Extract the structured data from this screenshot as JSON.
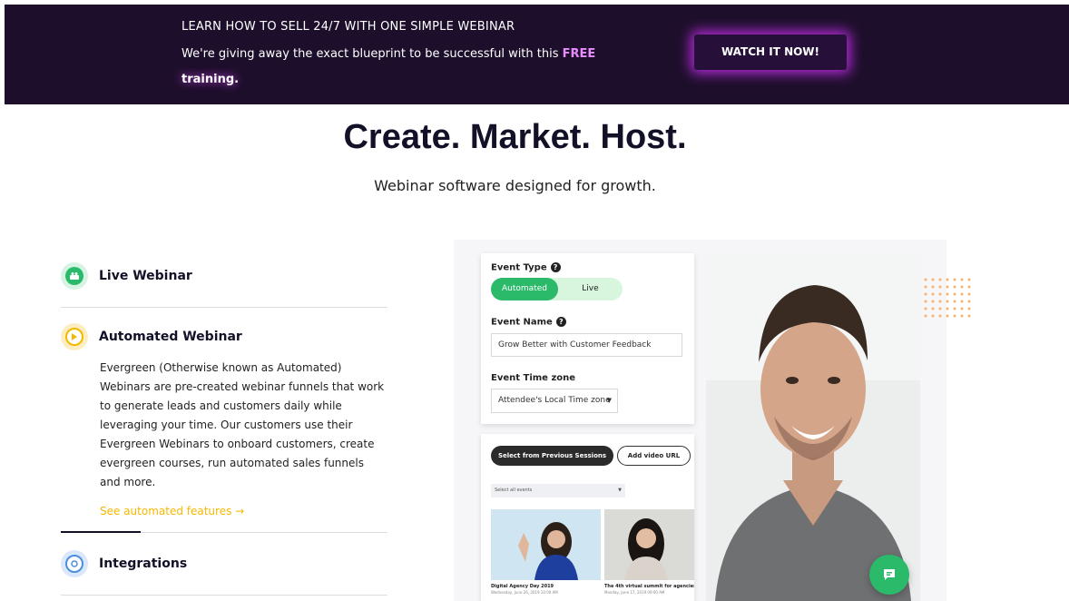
{
  "banner": {
    "title": "LEARN HOW TO SELL 24/7 WITH ONE SIMPLE WEBINAR",
    "text_prefix": "We're giving away the exact blueprint to be successful with this ",
    "text_free": "FREE",
    "text_training": "training.",
    "cta_label": "WATCH IT NOW!"
  },
  "hero": {
    "headline": "Create. Market. Host.",
    "subline": "Webinar software designed for growth."
  },
  "features": {
    "live_label": "Live Webinar",
    "automated_label": "Automated Webinar",
    "automated_desc": "Evergreen (Otherwise known as Automated) Webinars are pre-created webinar funnels that work to generate leads and customers daily while leveraging your time. Our customers use their Evergreen Webinars to onboard customers, create evergreen courses, run automated sales funnels and more.",
    "automated_link": "See automated features →",
    "integrations_label": "Integrations"
  },
  "app": {
    "event_type_label": "Event Type",
    "toggle_automated": "Automated",
    "toggle_live": "Live",
    "event_name_label": "Event Name",
    "event_name_value": "Grow Better with Customer Feedback",
    "event_tz_label": "Event Time zone",
    "event_tz_value": "Attendee's Local Time zone",
    "select_prev_label": "Select from Previous Sessions",
    "add_video_label": "Add video URL",
    "select_events_placeholder": "Select all events",
    "session1_title": "Digital Agency Day 2019",
    "session1_date": "Wednesday, June 26, 2019 10:00 AM",
    "session2_title": "The 4th virtual summit for agencies -",
    "session2_date": "Monday, June 17, 2019 09:00 AM"
  },
  "colors": {
    "banner_bg": "#1d0f2b",
    "cta_glow": "#b52bd9",
    "accent_green": "#2aba6a",
    "accent_yellow": "#f5b800",
    "accent_blue": "#4a90e2"
  },
  "icons": {
    "live": "camera-people-icon",
    "automated": "play-icon",
    "integrations": "sync-icon",
    "help": "question-circle-icon",
    "chat": "chat-bubble-icon"
  }
}
